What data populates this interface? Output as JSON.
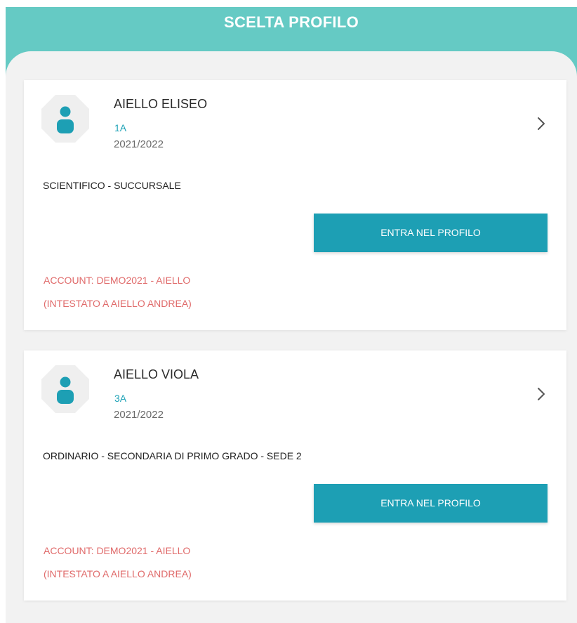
{
  "header": {
    "title": "SCELTA PROFILO"
  },
  "profiles": [
    {
      "name": "AIELLO ELISEO",
      "class": "1A",
      "year": "2021/2022",
      "school": "SCIENTIFICO - SUCCURSALE",
      "enter_label": "ENTRA NEL PROFILO",
      "account": "ACCOUNT: DEMO2021 - AIELLO",
      "owner": "(INTESTATO A AIELLO ANDREA)"
    },
    {
      "name": "AIELLO VIOLA",
      "class": "3A",
      "year": "2021/2022",
      "school": "ORDINARIO - SECONDARIA DI PRIMO GRADO - SEDE 2",
      "enter_label": "ENTRA NEL PROFILO",
      "account": "ACCOUNT: DEMO2021 - AIELLO",
      "owner": "(INTESTATO A AIELLO ANDREA)"
    }
  ],
  "icons": {
    "avatar": "user-icon",
    "chevron": "chevron-right-icon"
  },
  "colors": {
    "header_bg": "#65cac4",
    "panel_bg": "#f2f2f2",
    "accent": "#1d9fb4",
    "class_text": "#1fa3b7",
    "account_text": "#e06b6b",
    "avatar_bg": "#efefef"
  }
}
